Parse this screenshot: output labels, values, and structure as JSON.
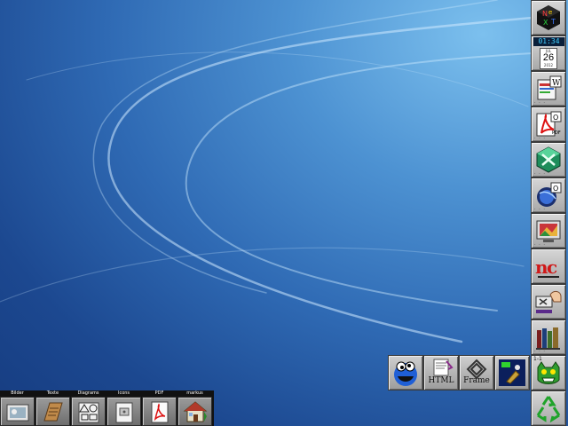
{
  "desktop": {
    "wallpaper": "blue abstract curves",
    "colors": {
      "wallpaper_dark": "#163c80",
      "wallpaper_light": "#7cc0ee",
      "shelf_bg": "#111111",
      "tile_gray": "#b0b0b0"
    }
  },
  "dock_right": {
    "tiles": [
      {
        "icon": "nextstep-cube-icon"
      },
      {
        "icon": "clock-calendar-icon",
        "time": "01:34",
        "month": "JUL",
        "day": "26",
        "year": "2012"
      },
      {
        "icon": "word-processor-icon"
      },
      {
        "icon": "pdf-viewer-icon"
      },
      {
        "icon": "geometry-app-icon"
      },
      {
        "icon": "web-browser-icon"
      },
      {
        "icon": "image-viewer-icon"
      },
      {
        "icon": "ncftp-icon"
      },
      {
        "icon": "terminal-hand-icon"
      },
      {
        "icon": "library-books-icon"
      },
      {
        "icon": "green-monster-icon",
        "badge": "1-1"
      },
      {
        "icon": "recycler-icon"
      }
    ]
  },
  "dock_bottom": {
    "tiles": [
      {
        "icon": "cookie-monster-icon",
        "label": ""
      },
      {
        "icon": "html-editor-icon",
        "label": "HTML"
      },
      {
        "icon": "framemaker-icon",
        "label": "Frame"
      },
      {
        "icon": "game-app-icon",
        "label": ""
      }
    ]
  },
  "shelf": {
    "tabs": [
      {
        "label": "Bilder",
        "icon": "image-folder-icon"
      },
      {
        "label": "Texte",
        "icon": "text-folder-icon"
      },
      {
        "label": "Diagrams",
        "icon": "diagram-folder-icon"
      },
      {
        "label": "Icons",
        "icon": "icons-folder-icon"
      },
      {
        "label": "PDF",
        "icon": "pdf-folder-icon"
      },
      {
        "label": "markus",
        "icon": "home-folder-icon"
      }
    ]
  }
}
